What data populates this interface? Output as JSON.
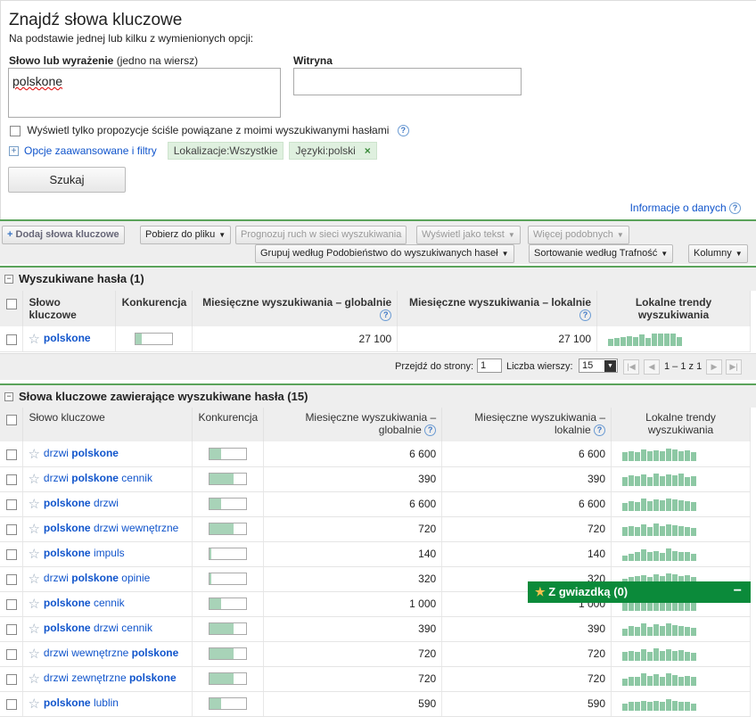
{
  "header": {
    "title": "Znajdź słowa kluczowe",
    "subtitle": "Na podstawie jednej lub kilku z wymienionych opcji:",
    "kw_label_bold": "Słowo lub wyrażenie",
    "kw_label_rest": " (jedno na wiersz)",
    "kw_value": "polskone",
    "site_label": "Witryna",
    "exact_checkbox_label": "Wyświetl tylko propozycje ściśle powiązane z moimi wyszukiwanymi hasłami",
    "advanced_link": "Opcje zaawansowane i filtry",
    "chip_location": "Lokalizacje:Wszystkie",
    "chip_language": "Języki:polski",
    "search_button": "Szukaj",
    "info_link": "Informacje o danych"
  },
  "toolbar": {
    "add": "Dodaj słowa kluczowe",
    "download": "Pobierz do pliku",
    "forecast": "Prognozuj ruch w sieci wyszukiwania",
    "view_text": "Wyświetl jako tekst",
    "more_similar": "Więcej podobnych",
    "group": "Grupuj według Podobieństwo do wyszukiwanych haseł",
    "sort": "Sortowanie według Trafność",
    "columns": "Kolumny"
  },
  "section1": {
    "title": "Wyszukiwane hasła (1)",
    "headers": {
      "kw": "Słowo kluczowe",
      "comp": "Konkurencja",
      "global": "Miesięczne wyszukiwania – globalnie",
      "local": "Miesięczne wyszukiwania – lokalnie",
      "trend_a": "Lokalne trendy",
      "trend_b": "wyszukiwania"
    },
    "rows": [
      {
        "kw": "polskone",
        "global": "27 100",
        "local": "27 100",
        "comp": 0.15,
        "trend": [
          0.5,
          0.55,
          0.6,
          0.7,
          0.6,
          0.8,
          0.55,
          0.9,
          0.85,
          0.9,
          0.9,
          0.6
        ]
      }
    ]
  },
  "pager": {
    "go_to": "Przejdź do strony:",
    "page": "1",
    "rows_label": "Liczba wierszy:",
    "rows": "15",
    "range": "1 – 1 z 1"
  },
  "section2": {
    "title": "Słowa kluczowe zawierające wyszukiwane hasła (15)",
    "headers": {
      "kw": "Słowo kluczowe",
      "comp": "Konkurencja",
      "global_a": "Miesięczne wyszukiwania –",
      "global_b": "globalnie",
      "local_a": "Miesięczne wyszukiwania –",
      "local_b": "lokalnie",
      "trend_a": "Lokalne trendy",
      "trend_b": "wyszukiwania"
    },
    "rows": [
      {
        "pre": "drzwi ",
        "bold": "polskone",
        "post": "",
        "global": "6 600",
        "local": "6 600",
        "comp": 0.3,
        "trend": [
          0.6,
          0.7,
          0.65,
          0.8,
          0.7,
          0.75,
          0.7,
          0.85,
          0.8,
          0.7,
          0.75,
          0.65
        ]
      },
      {
        "pre": "drzwi ",
        "bold": "polskone",
        "post": " cennik",
        "global": "390",
        "local": "390",
        "comp": 0.65,
        "trend": [
          0.6,
          0.75,
          0.7,
          0.8,
          0.6,
          0.9,
          0.7,
          0.8,
          0.75,
          0.85,
          0.6,
          0.7
        ]
      },
      {
        "pre": "",
        "bold": "polskone",
        "post": " drzwi",
        "global": "6 600",
        "local": "6 600",
        "comp": 0.3,
        "trend": [
          0.55,
          0.7,
          0.65,
          0.85,
          0.7,
          0.8,
          0.75,
          0.9,
          0.8,
          0.75,
          0.7,
          0.6
        ]
      },
      {
        "pre": "",
        "bold": "polskone",
        "post": " drzwi wewnętrzne",
        "global": "720",
        "local": "720",
        "comp": 0.65,
        "trend": [
          0.6,
          0.7,
          0.65,
          0.8,
          0.6,
          0.85,
          0.7,
          0.8,
          0.75,
          0.7,
          0.65,
          0.55
        ]
      },
      {
        "pre": "",
        "bold": "polskone",
        "post": " impuls",
        "global": "140",
        "local": "140",
        "comp": 0.05,
        "trend": [
          0.4,
          0.5,
          0.6,
          0.8,
          0.6,
          0.7,
          0.55,
          0.85,
          0.7,
          0.6,
          0.65,
          0.5
        ]
      },
      {
        "pre": "drzwi ",
        "bold": "polskone",
        "post": " opinie",
        "global": "320",
        "local": "320",
        "comp": 0.05,
        "trend": [
          0.5,
          0.6,
          0.7,
          0.75,
          0.65,
          0.8,
          0.7,
          0.85,
          0.8,
          0.7,
          0.75,
          0.6
        ]
      },
      {
        "pre": "",
        "bold": "polskone",
        "post": " cennik",
        "global": "1 000",
        "local": "1 000",
        "comp": 0.3,
        "trend": [
          0.55,
          0.65,
          0.6,
          0.8,
          0.7,
          0.75,
          0.65,
          0.9,
          0.8,
          0.7,
          0.7,
          0.6
        ]
      },
      {
        "pre": "",
        "bold": "polskone",
        "post": " drzwi cennik",
        "global": "390",
        "local": "390",
        "comp": 0.65,
        "trend": [
          0.5,
          0.7,
          0.6,
          0.85,
          0.6,
          0.8,
          0.7,
          0.9,
          0.75,
          0.7,
          0.65,
          0.55
        ]
      },
      {
        "pre": "drzwi wewnętrzne ",
        "bold": "polskone",
        "post": "",
        "global": "720",
        "local": "720",
        "comp": 0.65,
        "trend": [
          0.6,
          0.7,
          0.65,
          0.8,
          0.65,
          0.85,
          0.7,
          0.8,
          0.7,
          0.75,
          0.6,
          0.55
        ]
      },
      {
        "pre": "drzwi zewnętrzne ",
        "bold": "polskone",
        "post": "",
        "global": "720",
        "local": "720",
        "comp": 0.65,
        "trend": [
          0.5,
          0.6,
          0.65,
          0.85,
          0.7,
          0.8,
          0.6,
          0.9,
          0.75,
          0.65,
          0.7,
          0.6
        ]
      },
      {
        "pre": "",
        "bold": "polskone",
        "post": " lublin",
        "global": "590",
        "local": "590",
        "comp": 0.3,
        "trend": [
          0.5,
          0.6,
          0.6,
          0.7,
          0.6,
          0.7,
          0.6,
          0.8,
          0.7,
          0.6,
          0.6,
          0.5
        ]
      }
    ]
  },
  "starred_panel": {
    "label": "Z gwiazdką (0)"
  }
}
